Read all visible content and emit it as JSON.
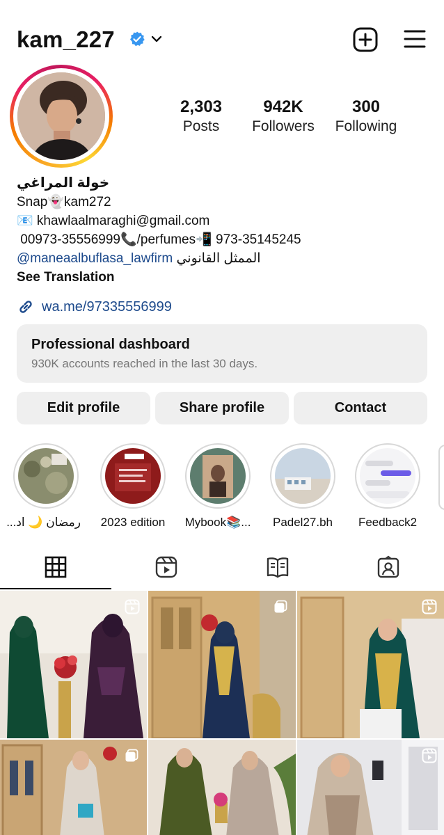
{
  "header": {
    "username": "kam_227",
    "icons": [
      "verified-badge-icon",
      "chevron-down-icon",
      "new-post-plus-icon",
      "hamburger-menu-icon"
    ]
  },
  "stats": {
    "posts": {
      "value": "2,303",
      "label": "Posts"
    },
    "followers": {
      "value": "942K",
      "label": "Followers"
    },
    "following": {
      "value": "300",
      "label": "Following"
    }
  },
  "bio": {
    "name": "خولة المراغي",
    "line1": "Snap👻kam272",
    "line2": "📧 khawlaalmaraghi@gmail.com",
    "line3": " 00973-35556999📞/perfumes📲 973-35145245",
    "mention": "@maneaalbuflasa_lawfirm",
    "mention_suffix": " الممثل القانوني",
    "see_translation": "See Translation",
    "link": "wa.me/97335556999"
  },
  "dashboard": {
    "title": "Professional dashboard",
    "subtitle": "930K accounts reached in the last 30 days."
  },
  "buttons": {
    "edit": "Edit profile",
    "share": "Share profile",
    "contact": "Contact"
  },
  "highlights": [
    {
      "label": "رمضان 🌙 اد..."
    },
    {
      "label": "2023 edition"
    },
    {
      "label": "Mybook📚..."
    },
    {
      "label": "Padel27.bh"
    },
    {
      "label": "Feedback2"
    }
  ],
  "tabs": [
    "grid-icon",
    "reels-icon",
    "guide-icon",
    "tagged-icon"
  ],
  "colors": {
    "link": "#1d4a8c",
    "button_bg": "#efefef",
    "verified": "#3897f0",
    "ring_start": "#f9a825",
    "ring_end": "#e91e63"
  }
}
